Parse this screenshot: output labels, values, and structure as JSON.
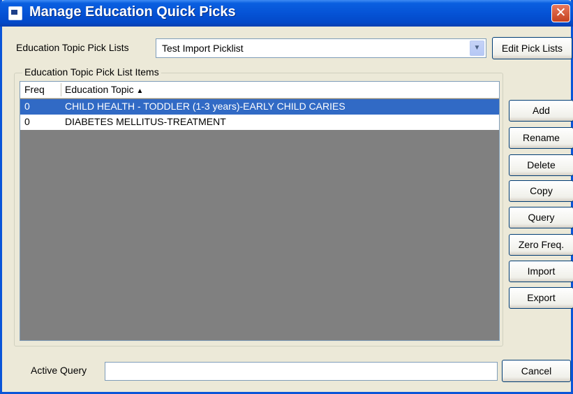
{
  "window": {
    "title": "Manage Education Quick Picks",
    "close_glyph": "✕"
  },
  "picklist": {
    "label": "Education Topic Pick Lists",
    "selected": "Test Import Picklist",
    "edit_button": "Edit Pick Lists"
  },
  "group": {
    "legend": "Education Topic Pick List Items"
  },
  "table": {
    "columns": [
      "Freq",
      "Education Topic"
    ],
    "sort_glyph": "▲",
    "rows": [
      {
        "freq": "0",
        "topic": "CHILD HEALTH - TODDLER (1-3 years)-EARLY CHILD CARIES",
        "selected": true
      },
      {
        "freq": "0",
        "topic": "DIABETES MELLITUS-TREATMENT",
        "selected": false
      }
    ]
  },
  "side_buttons": [
    "Add",
    "Rename",
    "Delete",
    "Copy",
    "Query",
    "Zero Freq.",
    "Import",
    "Export"
  ],
  "footer": {
    "active_query_label": "Active Query",
    "active_query_value": "",
    "cancel_button": "Cancel"
  },
  "colors": {
    "titlebar": "#0553d6",
    "selection": "#316ac5",
    "window_bg": "#ece9d8",
    "list_bg": "#808080"
  },
  "icons": {
    "title": "window-app-icon",
    "close": "close-icon",
    "dropdown": "chevron-down-icon",
    "sort": "sort-ascending-icon"
  }
}
